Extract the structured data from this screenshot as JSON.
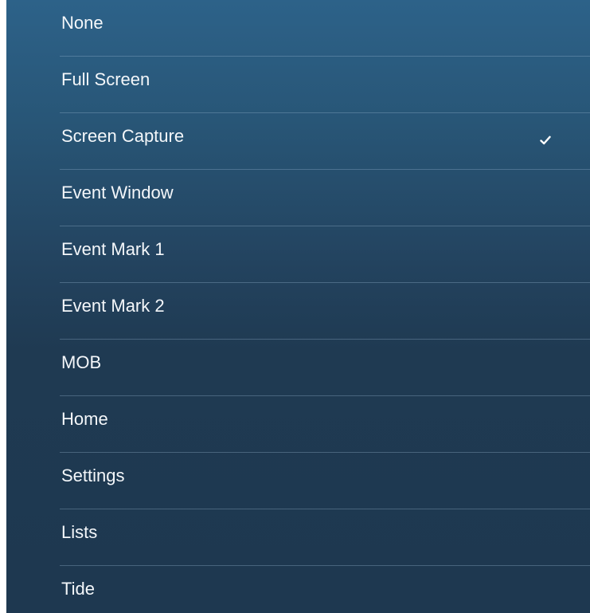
{
  "menu": {
    "items": [
      {
        "label": "None",
        "checked": false
      },
      {
        "label": "Full Screen",
        "checked": false
      },
      {
        "label": "Screen Capture",
        "checked": true
      },
      {
        "label": "Event Window",
        "checked": false
      },
      {
        "label": "Event Mark 1",
        "checked": false
      },
      {
        "label": "Event Mark 2",
        "checked": false
      },
      {
        "label": "MOB",
        "checked": false
      },
      {
        "label": "Home",
        "checked": false
      },
      {
        "label": "Settings",
        "checked": false
      },
      {
        "label": "Lists",
        "checked": false
      },
      {
        "label": "Tide",
        "checked": false
      }
    ],
    "check_icon": "checkmark-icon"
  },
  "colors": {
    "background_top": "#2d6289",
    "background_bottom": "#1e3850",
    "text": "#f4f7fa"
  }
}
